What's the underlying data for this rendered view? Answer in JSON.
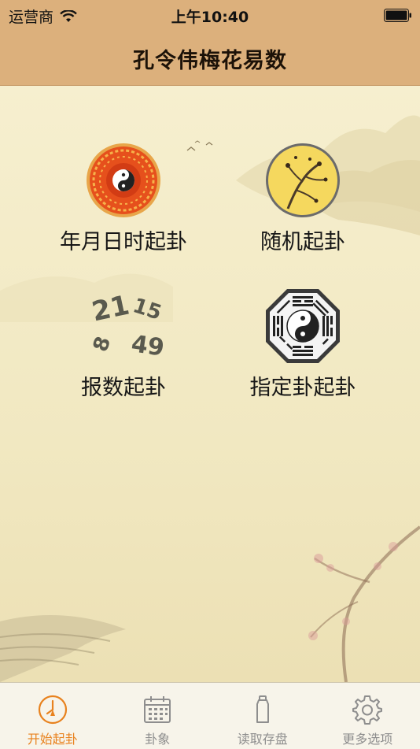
{
  "status_bar": {
    "carrier": "运营商",
    "time": "上午10:40"
  },
  "nav": {
    "title": "孔令伟梅花易数"
  },
  "options": [
    {
      "label": "年月日时起卦",
      "icon": "bagua-disc-icon"
    },
    {
      "label": "随机起卦",
      "icon": "plum-blossom-icon"
    },
    {
      "label": "报数起卦",
      "icon": "numbers-icon",
      "numbers": [
        "21",
        "15",
        "8",
        "49"
      ]
    },
    {
      "label": "指定卦起卦",
      "icon": "bagua-octagon-icon"
    }
  ],
  "tabs": [
    {
      "label": "开始起卦",
      "icon": "compass-icon",
      "active": true
    },
    {
      "label": "卦象",
      "icon": "calendar-icon",
      "active": false
    },
    {
      "label": "读取存盘",
      "icon": "bottle-icon",
      "active": false
    },
    {
      "label": "更多选项",
      "icon": "gear-icon",
      "active": false
    }
  ],
  "colors": {
    "header": "#dcb07c",
    "background": "#f3ecc8",
    "tab_active": "#e8821e",
    "tab_inactive": "#8e8e8e"
  }
}
